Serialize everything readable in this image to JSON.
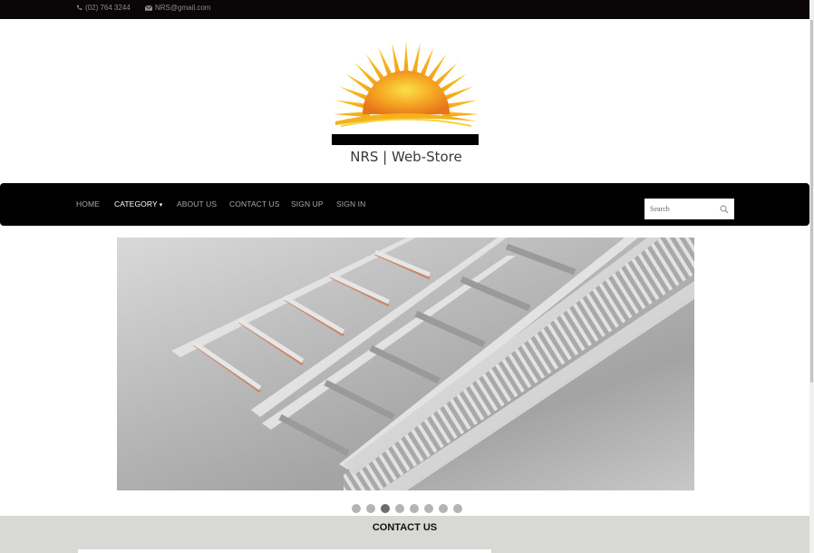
{
  "topbar": {
    "phone": "(02) 764 3244",
    "email": "NRS@gmail.com",
    "phone_icon": "phone-icon",
    "email_icon": "envelope-icon"
  },
  "logo": {
    "brand_text": "NRS | Web-Store",
    "icon": "sun-icon",
    "sun_colors": [
      "#f7c31a",
      "#f08a1b",
      "#e56a16"
    ],
    "bar_color": "#000000"
  },
  "nav": {
    "items": [
      {
        "label": "HOME",
        "active": false
      },
      {
        "label": "CATEGORY",
        "active": true,
        "dropdown": true
      },
      {
        "label": "ABOUT US",
        "active": false
      },
      {
        "label": "CONTACT US",
        "active": false
      },
      {
        "label": "SIGN UP",
        "active": false
      },
      {
        "label": "SIGN IN",
        "active": false
      }
    ],
    "caret": "▾",
    "search_placeholder": "Search",
    "search_icon": "search-icon"
  },
  "slider": {
    "image": "cable trays (ladder, perforated and channel types)",
    "dot_count": 8,
    "active_index": 2
  },
  "contact": {
    "title_part1": "CONTACT ",
    "title_part2": "US"
  }
}
